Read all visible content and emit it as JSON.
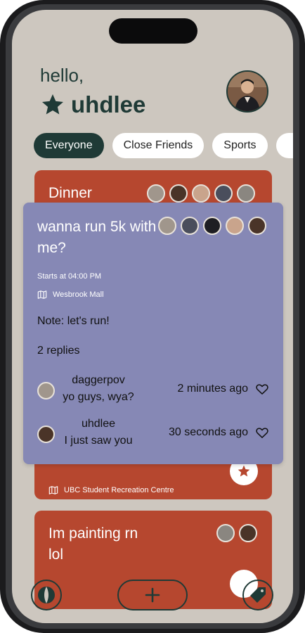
{
  "greeting": {
    "hello": "hello,",
    "username": "uhdlee"
  },
  "filters": [
    "Everyone",
    "Close Friends",
    "Sports"
  ],
  "events": [
    {
      "title": "Dinner",
      "location": "UBC Student Recreation Centre"
    },
    {
      "title": "Im painting rn lol"
    }
  ],
  "detail": {
    "title": "wanna run 5k with me?",
    "starts": "Starts at 04:00 PM",
    "location": "Wesbrook Mall",
    "note": "Note: let's run!",
    "replies_count": "2 replies",
    "replies": [
      {
        "user": "daggerpov",
        "message": "yo guys, wya?",
        "time": "2 minutes ago"
      },
      {
        "user": "uhdlee",
        "message": "I just saw you",
        "time": "30 seconds ago"
      }
    ]
  },
  "colors": {
    "background": "#cdc7bf",
    "accent_dark": "#1f3a36",
    "event_card": "#b6472f",
    "overlay": "#8688b5"
  },
  "icons": [
    "star-icon",
    "map-icon",
    "heart-icon",
    "plus-icon",
    "tag-icon",
    "globe-icon"
  ]
}
